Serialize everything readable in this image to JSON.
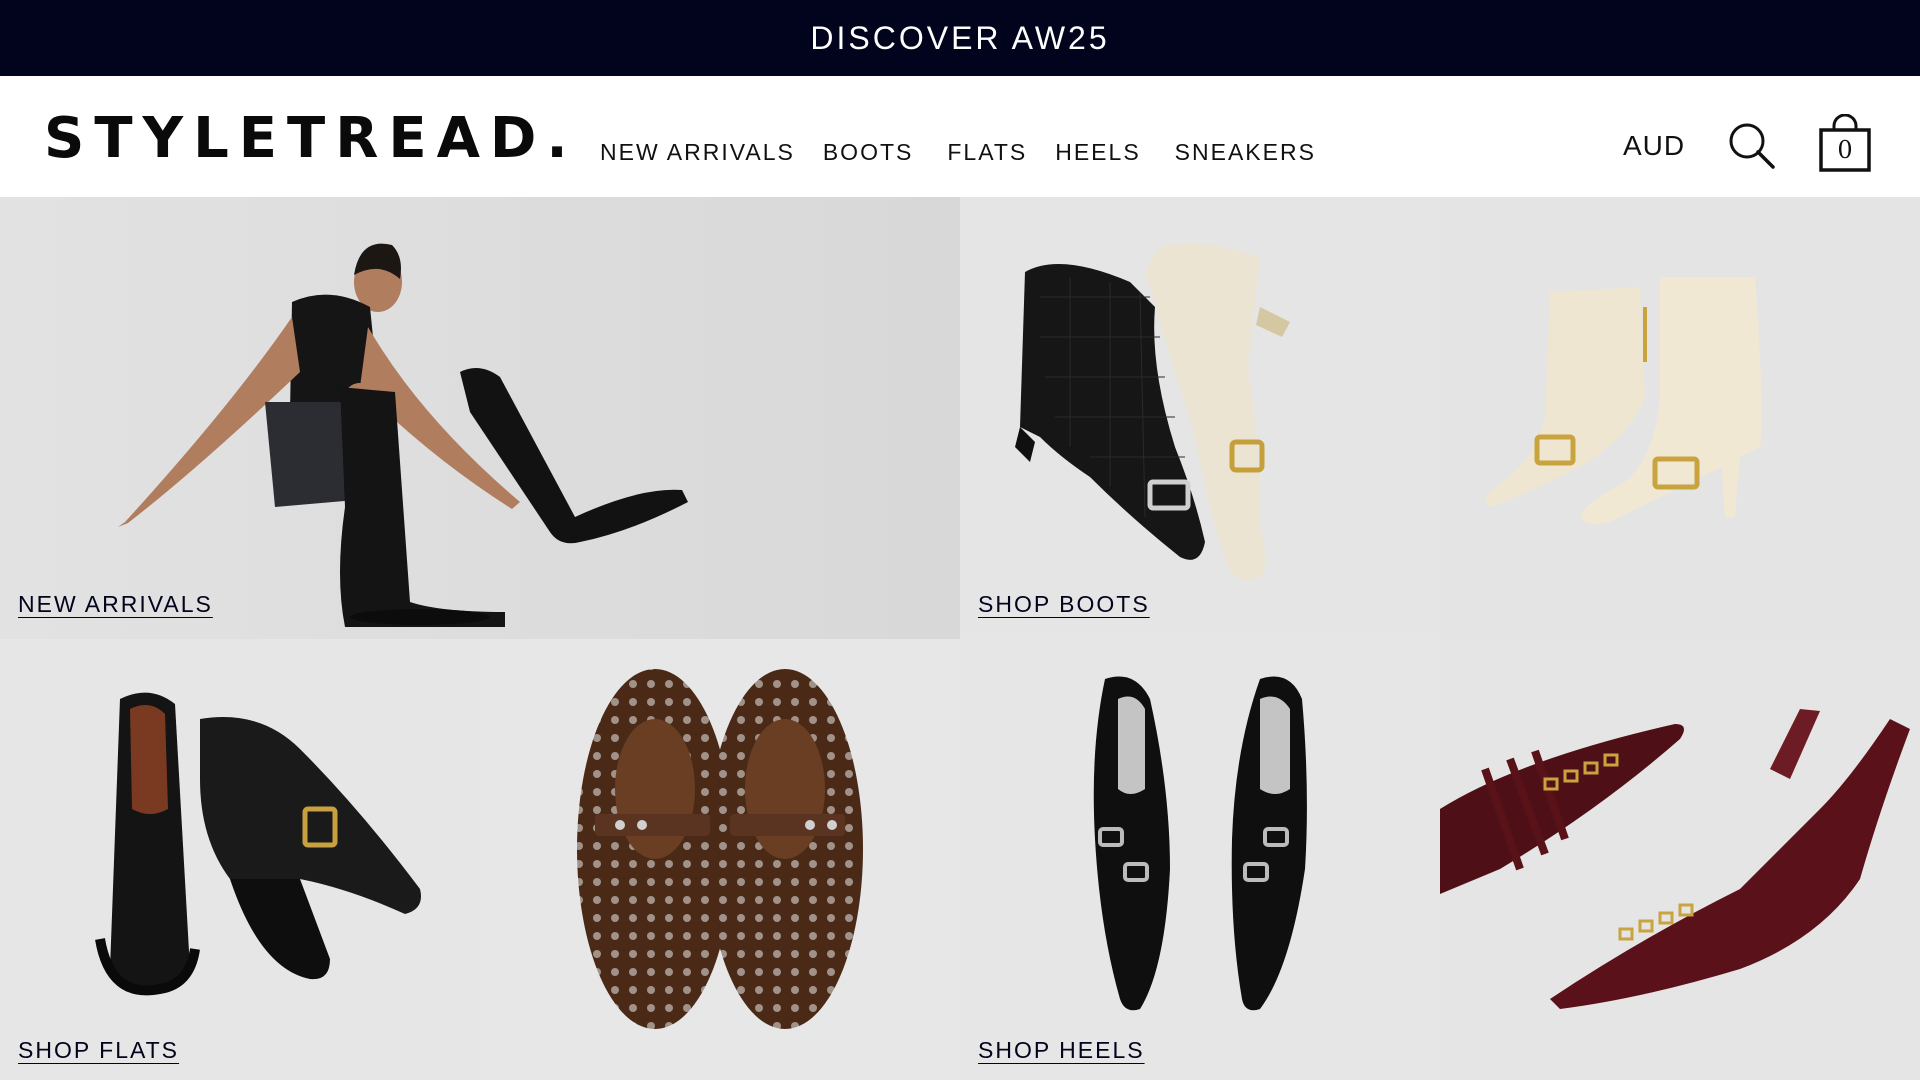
{
  "announcement": {
    "text": "DISCOVER AW25"
  },
  "header": {
    "logo": "STYLETREAD.",
    "nav": [
      {
        "label": "NEW ARRIVALS"
      },
      {
        "label": "BOOTS"
      },
      {
        "label": "FLATS"
      },
      {
        "label": "HEELS"
      },
      {
        "label": "SNEAKERS"
      }
    ],
    "currency": "AUD",
    "search_icon": "search-icon",
    "bag_icon": "shopping-bag-icon",
    "bag_count": "0"
  },
  "tiles": [
    {
      "label": "NEW ARRIVALS",
      "image": "model-in-black-knee-boots"
    },
    {
      "label": "SHOP BOOTS",
      "image": "croc-black-and-cream-ankle-boots"
    },
    {
      "label": "",
      "image": "cream-buckle-ankle-boots"
    },
    {
      "label": "SHOP FLATS",
      "image": "black-buckle-loafers"
    },
    {
      "label": "",
      "image": "brown-woven-mary-janes"
    },
    {
      "label": "SHOP HEELS",
      "image": "black-patent-buckle-pumps"
    },
    {
      "label": "",
      "image": "burgundy-buckle-slingbacks"
    }
  ],
  "colors": {
    "announcement_bg": "#02031c",
    "text": "#111111",
    "tile_bg": "#e6e6e6"
  }
}
